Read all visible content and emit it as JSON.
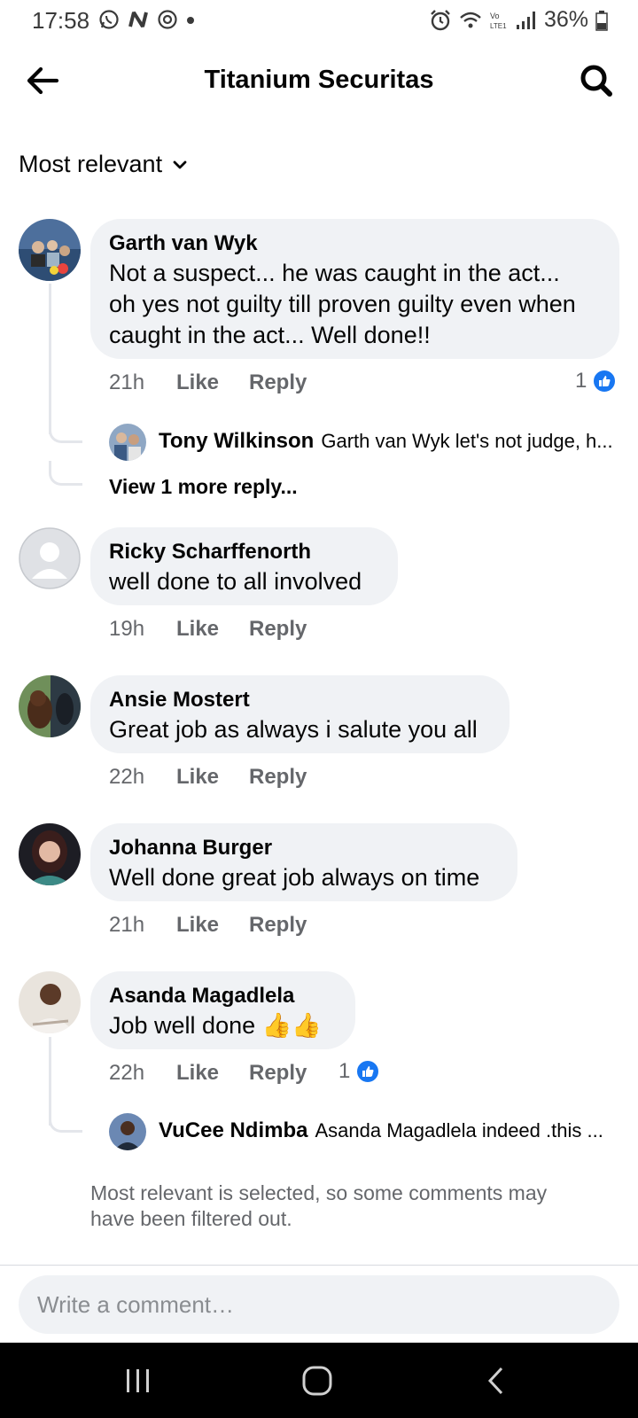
{
  "status_bar": {
    "time": "17:58",
    "battery": "36%",
    "left_icons": [
      "whatsapp-icon",
      "n-app-icon",
      "sync-icon",
      "dot-icon"
    ],
    "right_icons": [
      "alarm-icon",
      "wifi-icon",
      "volte-icon",
      "signal-icon",
      "battery-icon"
    ]
  },
  "header": {
    "title": "Titanium Securitas"
  },
  "sort": {
    "label": "Most relevant"
  },
  "comments": [
    {
      "name": "Garth van Wyk",
      "text": "Not a suspect... he was caught in the act... oh yes not guilty till proven guilty even when caught in the act... Well done!!",
      "lines": [
        "Not a suspect... he was caught in the act...",
        "oh yes not guilty till proven guilty even when",
        "caught in the act... Well done!!"
      ],
      "time": "21h",
      "like": "Like",
      "reply": "Reply",
      "reactions": "1",
      "reply_preview": {
        "name": "Tony Wilkinson",
        "text": "Garth van Wyk let's not judge, h..."
      },
      "view_more": "View 1 more reply..."
    },
    {
      "name": "Ricky Scharffenorth",
      "text": "well done to all involved",
      "time": "19h",
      "like": "Like",
      "reply": "Reply"
    },
    {
      "name": "Ansie Mostert",
      "text": "Great job as always i salute you all",
      "time": "22h",
      "like": "Like",
      "reply": "Reply"
    },
    {
      "name": "Johanna Burger",
      "text": "Well done great job always on time",
      "time": "21h",
      "like": "Like",
      "reply": "Reply"
    },
    {
      "name": "Asanda Magadlela",
      "text": "Job well done 👍👍",
      "time": "22h",
      "like": "Like",
      "reply": "Reply",
      "reactions": "1",
      "reply_preview": {
        "name": "VuCee Ndimba",
        "text": "Asanda Magadlela indeed .this ..."
      }
    }
  ],
  "filter_note": "Most relevant is selected, so some comments may have been filtered out.",
  "composer": {
    "placeholder": "Write a comment…"
  },
  "colors": {
    "accent": "#1877f2",
    "bubble": "#f0f2f5",
    "meta_text": "#65676b"
  }
}
